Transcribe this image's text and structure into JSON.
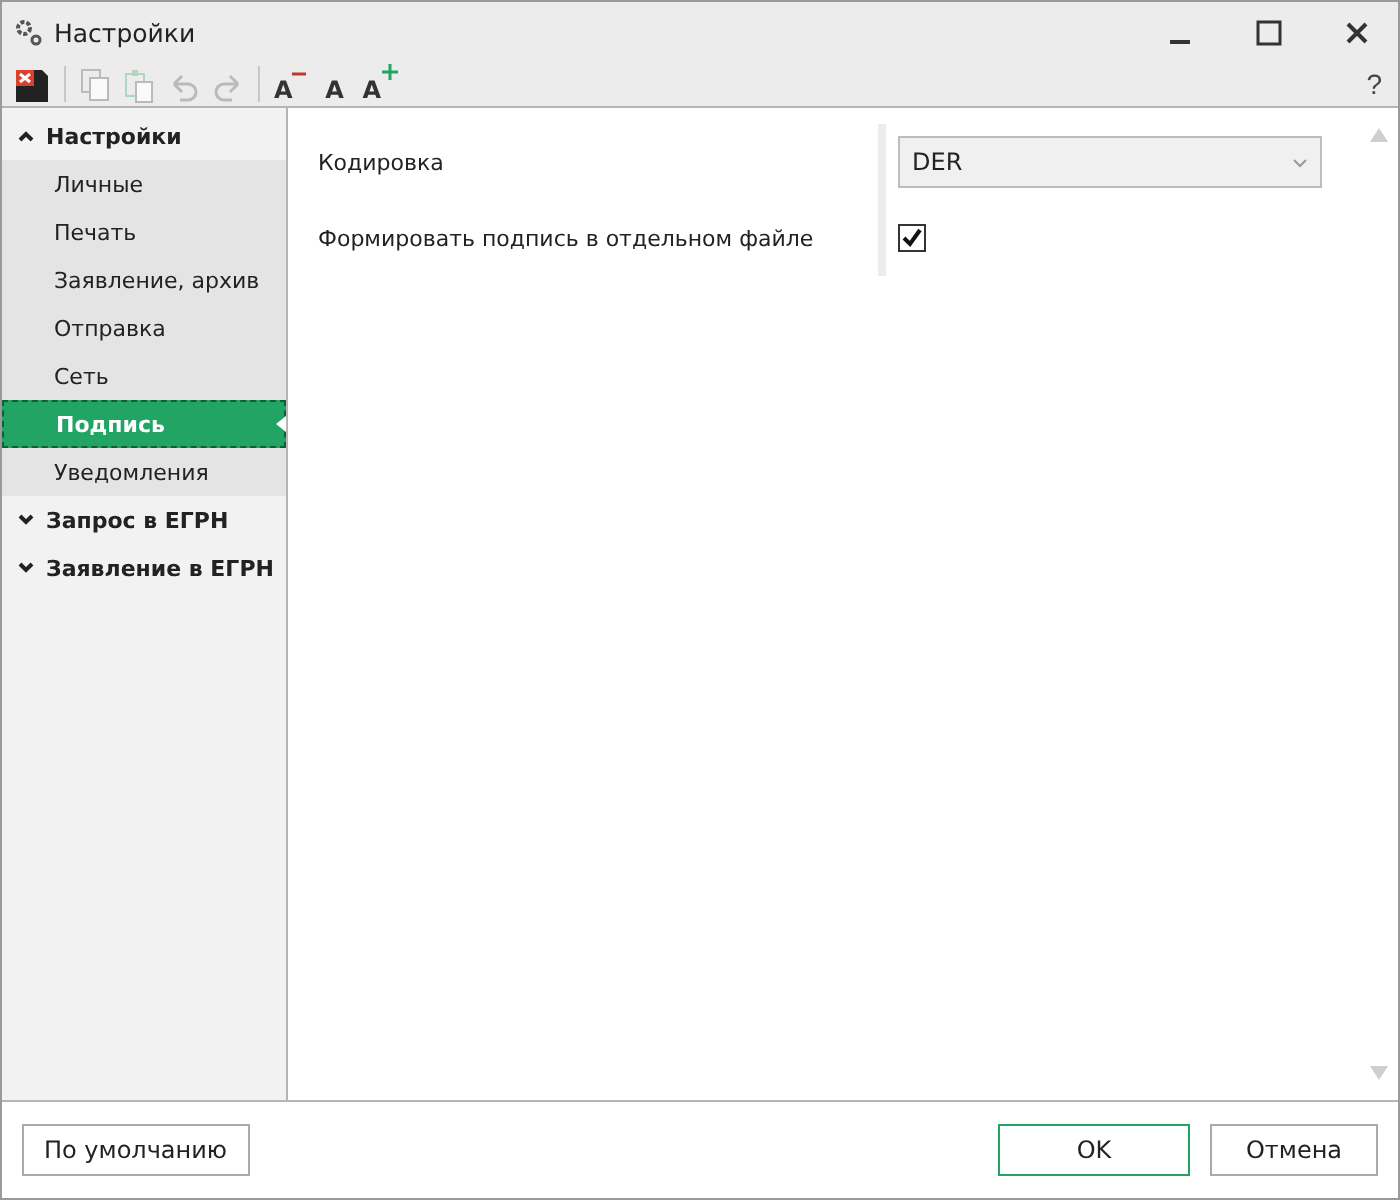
{
  "window": {
    "title": "Настройки"
  },
  "toolbar": [
    {
      "kind": "save-error",
      "disabled": false
    },
    {
      "kind": "divider"
    },
    {
      "kind": "copy",
      "disabled": true
    },
    {
      "kind": "paste",
      "disabled": true
    },
    {
      "kind": "undo",
      "disabled": true
    },
    {
      "kind": "redo",
      "disabled": true
    },
    {
      "kind": "divider"
    },
    {
      "kind": "font-smaller",
      "label": "A",
      "disabled": false
    },
    {
      "kind": "font-normal",
      "label": "A",
      "disabled": false
    },
    {
      "kind": "font-larger",
      "label": "A",
      "disabled": false
    }
  ],
  "help": "?",
  "sidebar": {
    "items": [
      {
        "label": "Настройки",
        "expanded": true,
        "children": [
          {
            "label": "Личные",
            "selected": false
          },
          {
            "label": "Печать",
            "selected": false
          },
          {
            "label": "Заявление, архив",
            "selected": false
          },
          {
            "label": "Отправка",
            "selected": false
          },
          {
            "label": "Сеть",
            "selected": false
          },
          {
            "label": "Подпись",
            "selected": true
          },
          {
            "label": "Уведомления",
            "selected": false
          }
        ]
      },
      {
        "label": "Запрос в ЕГРН",
        "expanded": false
      },
      {
        "label": "Заявление в ЕГРН",
        "expanded": false
      }
    ]
  },
  "settings": [
    {
      "kind": "select",
      "label": "Кодировка",
      "value": "DER"
    },
    {
      "kind": "checkbox",
      "label": "Формировать подпись в отдельном файле",
      "checked": true
    }
  ],
  "buttons": [
    {
      "label": "По умолчанию",
      "primary": false
    },
    {
      "label": "OK",
      "primary": true
    },
    {
      "label": "Отмена",
      "primary": false
    }
  ]
}
